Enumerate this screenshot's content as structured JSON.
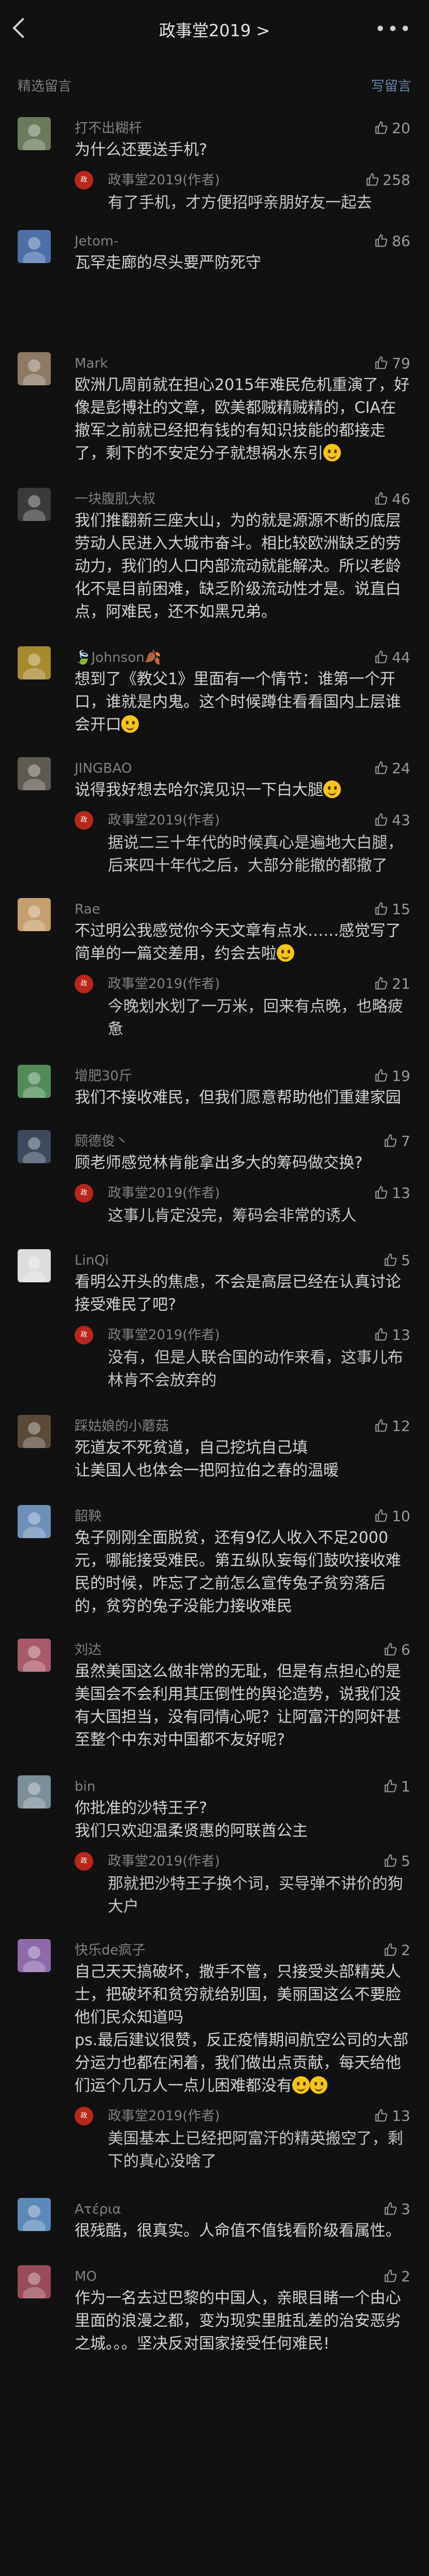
{
  "header": {
    "title": "政事堂2019 >",
    "more": "•••"
  },
  "section": {
    "label": "精选留言",
    "write": "写留言"
  },
  "colors": {
    "background": "#111111",
    "text": "#d2d2d2",
    "muted": "#818181",
    "link": "#6b83a8",
    "author_badge": "#b8261d"
  },
  "icons": {
    "like": "thumbs-up-outline-icon",
    "back": "chevron-left-icon",
    "more": "more-dots-icon",
    "emoji": "smiling-face-emoji"
  },
  "comments": [
    {
      "name": "打不出糊杆",
      "likes": "20",
      "text": "为什么还要送手机?",
      "reply": {
        "name": "政事堂2019(作者)",
        "likes": "258",
        "text": "有了手机，才方便招呼亲朋好友一起去"
      }
    },
    {
      "name": "Jetom-",
      "likes": "86",
      "text": "瓦罕走廊的尽头要严防死守"
    },
    {
      "name": "Mark",
      "likes": "79",
      "text": "欧洲几周前就在担心2015年难民危机重演了，好像是彭博社的文章，欧美都贼精贼精的，CIA在撤军之前就已经把有钱的有知识技能的都接走了，剩下的不安定分子就想祸水东引"
    },
    {
      "name": "一块腹肌大叔",
      "likes": "46",
      "text": "我们推翻新三座大山，为的就是源源不断的底层劳动人民进入大城市奋斗。相比较欧洲缺乏的劳动力，我们的人口内部流动就能解决。所以老龄化不是目前困难，缺乏阶级流动性才是。说直白点，阿难民，还不如黑兄弟。"
    },
    {
      "name": "🍃Johnson🍂",
      "likes": "44",
      "text": "想到了《教父1》里面有一个情节：谁第一个开口，谁就是内鬼。这个时候蹲住看看国内上层谁会开口"
    },
    {
      "name": "JINGBAO",
      "likes": "24",
      "text": "说得我好想去哈尔滨见识一下白大腿",
      "reply": {
        "name": "政事堂2019(作者)",
        "likes": "43",
        "text": "据说二三十年代的时候真心是遍地大白腿，后来四十年代之后，大部分能撤的都撤了"
      }
    },
    {
      "name": "Rae",
      "likes": "15",
      "text": "不过明公我感觉你今天文章有点水……感觉写了简单的一篇交差用，约会去啦",
      "reply": {
        "name": "政事堂2019(作者)",
        "likes": "21",
        "text": "今晚划水划了一万米，回来有点晚，也略疲惫"
      }
    },
    {
      "name": "增肥30斤",
      "likes": "19",
      "text": "我们不接收难民，但我们愿意帮助他们重建家园"
    },
    {
      "name": "顾德俊丶",
      "likes": "7",
      "text": "顾老师感觉林肯能拿出多大的筹码做交换?",
      "reply": {
        "name": "政事堂2019(作者)",
        "likes": "13",
        "text": "这事儿肯定没完，筹码会非常的诱人"
      }
    },
    {
      "name": "LinQi",
      "likes": "5",
      "text": "看明公开头的焦虑，不会是高层已经在认真讨论接受难民了吧?",
      "reply": {
        "name": "政事堂2019(作者)",
        "likes": "13",
        "text": "没有，但是人联合国的动作来看，这事儿布林肯不会放弃的"
      }
    },
    {
      "name": "踩姑娘的小蘑菇",
      "likes": "12",
      "text": "死道友不死贫道，自己挖坑自己填\n让美国人也体会一把阿拉伯之春的温暖"
    },
    {
      "name": "韶鞅",
      "likes": "10",
      "text": "兔子刚刚全面脱贫，还有9亿人收入不足2000元，哪能接受难民。第五纵队妄每们鼓吹接收难民的时候，咋忘了之前怎么宣传兔子贫穷落后的，贫穷的兔子没能力接收难民"
    },
    {
      "name": "刘达",
      "likes": "6",
      "text": "虽然美国这么做非常的无耻，但是有点担心的是美国会不会利用其压倒性的舆论造势，说我们没有大国担当，没有同情心呢？让阿富汗的阿奸甚至整个中东对中国都不友好呢?"
    },
    {
      "name": "bin",
      "likes": "1",
      "text": "你批准的沙特王子?\n我们只欢迎温柔贤惠的阿联酋公主",
      "reply": {
        "name": "政事堂2019(作者)",
        "likes": "5",
        "text": "那就把沙特王子换个词，买导弹不讲价的狗大户"
      }
    },
    {
      "name": "快乐de疯子",
      "likes": "2",
      "text": "自己天天搞破坏，撒手不管，只接受头部精英人士，把破坏和贫穷就给别国，美丽国这么不要脸他们民众知道吗\nps.最后建议很赞，反正疫情期间航空公司的大部分运力也都在闲着，我们做出点贡献，每天给他们运个几万人一点儿困难都没有",
      "reply": {
        "name": "政事堂2019(作者)",
        "likes": "13",
        "text": "美国基本上已经把阿富汗的精英搬空了，剩下的真心没啥了"
      }
    },
    {
      "name": "Ατέρια",
      "likes": "3",
      "text": "很残酷，很真实。人命值不值钱看阶级看属性。"
    },
    {
      "name": "MO",
      "likes": "2",
      "text": "作为一名去过巴黎的中国人，亲眼目睹一个由心里面的浪漫之都，变为现实里脏乱差的治安恶劣之城。。。坚决反对国家接受任何难民!"
    }
  ]
}
